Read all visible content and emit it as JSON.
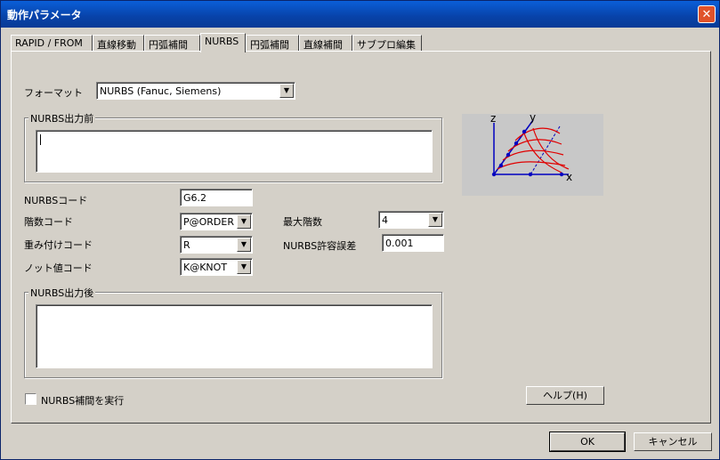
{
  "window": {
    "title": "動作パラメータ",
    "close_glyph": "✕"
  },
  "tabs": [
    {
      "label": "RAPID / FROM"
    },
    {
      "label": "直線移動"
    },
    {
      "label": "円弧補間"
    },
    {
      "label": "NURBS",
      "active": true
    },
    {
      "label": "円弧補間"
    },
    {
      "label": "直線補間"
    },
    {
      "label": "サブプロ編集"
    }
  ],
  "format": {
    "label": "フォーマット",
    "value": "NURBS (Fanuc, Siemens)"
  },
  "nurbs_before": {
    "legend": "NURBS出力前",
    "value": ""
  },
  "nurbs_code": {
    "label": "NURBSコード",
    "value": "G6.2"
  },
  "order_code": {
    "label": "階数コード",
    "value": "P@ORDER"
  },
  "weight_code": {
    "label": "重み付けコード",
    "value": "R"
  },
  "knot_code": {
    "label": "ノット値コード",
    "value": "K@KNOT"
  },
  "max_order": {
    "label": "最大階数",
    "value": "4"
  },
  "tolerance": {
    "label": "NURBS許容誤差",
    "value": "0.001"
  },
  "nurbs_after": {
    "legend": "NURBS出力後",
    "value": ""
  },
  "execute_checkbox": {
    "label": "NURBS補間を実行",
    "checked": false
  },
  "help_button": {
    "label": "ヘルプ(H)"
  },
  "ok_button": {
    "label": "OK"
  },
  "cancel_button": {
    "label": "キャンセル"
  },
  "preview": {
    "axis_z": "z",
    "axis_y": "y",
    "axis_x": "x",
    "curve_color": "#e00000",
    "axis_color": "#0000c0"
  },
  "dropdown_arrow": "▼"
}
